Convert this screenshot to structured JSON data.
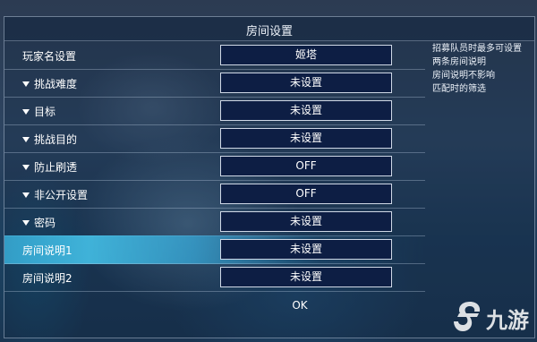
{
  "dialog": {
    "title": "房间设置",
    "ok_label": "OK"
  },
  "rows": [
    {
      "label": "玩家名设置",
      "value": "姬塔",
      "has_filter": false
    },
    {
      "label": "挑战难度",
      "value": "未设置",
      "has_filter": true
    },
    {
      "label": "目标",
      "value": "未设置",
      "has_filter": true
    },
    {
      "label": "挑战目的",
      "value": "未设置",
      "has_filter": true
    },
    {
      "label": "防止刷透",
      "value": "OFF",
      "has_filter": true
    },
    {
      "label": "非公开设置",
      "value": "OFF",
      "has_filter": true
    },
    {
      "label": "密码",
      "value": "未设置",
      "has_filter": true
    },
    {
      "label": "房间说明1",
      "value": "未设置",
      "has_filter": false,
      "selected": true
    },
    {
      "label": "房间说明2",
      "value": "未设置",
      "has_filter": false
    }
  ],
  "help": {
    "lines": [
      "招募队员时最多可设置",
      "两条房间说明",
      "房间说明不影响",
      "匹配时的筛选"
    ]
  },
  "watermark": {
    "text": "九游",
    "icon": "jiuyou-logo-icon"
  }
}
